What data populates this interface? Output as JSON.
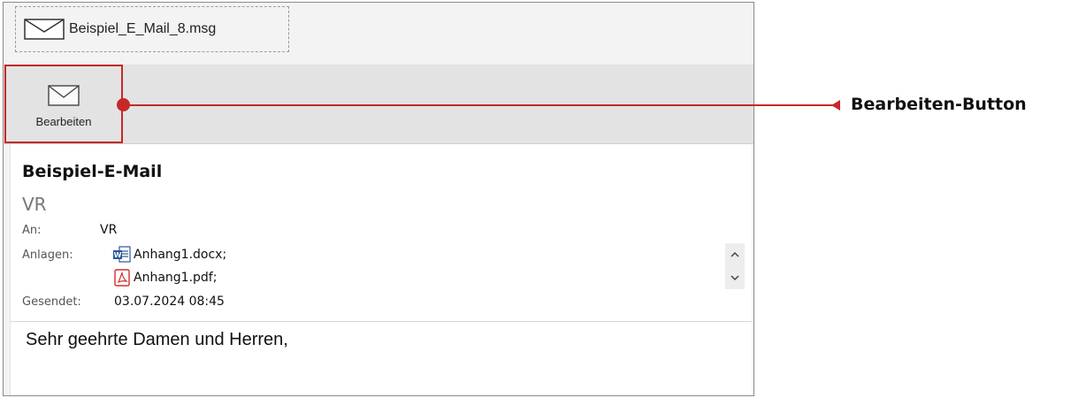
{
  "file_tab": {
    "name": "Beispiel_E_Mail_8.msg",
    "icon": "envelope-icon"
  },
  "ribbon": {
    "edit_label": "Bearbeiten",
    "edit_icon": "envelope-icon"
  },
  "message": {
    "subject": "Beispiel-E-Mail",
    "sender": "VR",
    "to_label": "An:",
    "to_value": "VR",
    "attachments_label": "Anlagen:",
    "attachments": [
      {
        "name": "Anhang1.docx;",
        "icon": "word-doc-icon"
      },
      {
        "name": "Anhang1.pdf;",
        "icon": "pdf-icon"
      }
    ],
    "sent_label": "Gesendet:",
    "sent_value": "03.07.2024 08:45",
    "body": "Sehr geehrte Damen und Herren,"
  },
  "annotation": {
    "label": "Bearbeiten-Button"
  },
  "colors": {
    "accent": "#c62828",
    "ribbon_bg": "#e3e3e3",
    "word_blue": "#2b5797",
    "pdf_red": "#d32f2f"
  }
}
